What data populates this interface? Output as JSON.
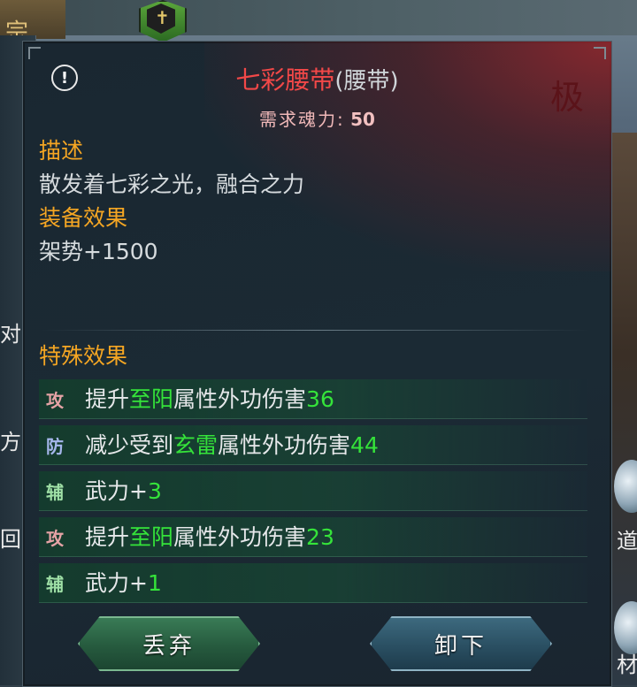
{
  "background": {
    "sect_char": "宗",
    "left_chars": [
      "对",
      "方",
      "回"
    ],
    "right_chars": [
      "道",
      "材"
    ]
  },
  "tooltip": {
    "item_name": "七彩腰带",
    "item_type": "(腰带)",
    "grade_char": "极",
    "requirement_label": "需求魂力:",
    "requirement_value": "50",
    "description_heading": "描述",
    "description_text": "散发着七彩之光，融合之力",
    "equip_effect_heading": "装备效果",
    "equip_effect_text": "架势+1500",
    "special_effect_heading": "特殊效果",
    "special_effects": [
      {
        "tag": "攻",
        "kind": "atk",
        "prefix": "提升",
        "highlight": "至阳",
        "middle": "属性外功伤害",
        "value": "36"
      },
      {
        "tag": "防",
        "kind": "def",
        "prefix": "减少受到",
        "highlight": "玄雷",
        "middle": "属性外功伤害",
        "value": "44"
      },
      {
        "tag": "辅",
        "kind": "aux",
        "prefix": "武力+",
        "highlight": "",
        "middle": "",
        "value": "3"
      },
      {
        "tag": "攻",
        "kind": "atk",
        "prefix": "提升",
        "highlight": "至阳",
        "middle": "属性外功伤害",
        "value": "23"
      },
      {
        "tag": "辅",
        "kind": "aux",
        "prefix": "武力+",
        "highlight": "",
        "middle": "",
        "value": "1"
      }
    ],
    "buttons": {
      "discard": "丢弃",
      "unequip": "卸下"
    }
  },
  "colors": {
    "title": "#f24848",
    "heading": "#f5a623",
    "highlight_green": "#35e33a",
    "panel_bg": "#1b2a34"
  },
  "icons": [
    "info-icon",
    "guild-shield-icon"
  ]
}
